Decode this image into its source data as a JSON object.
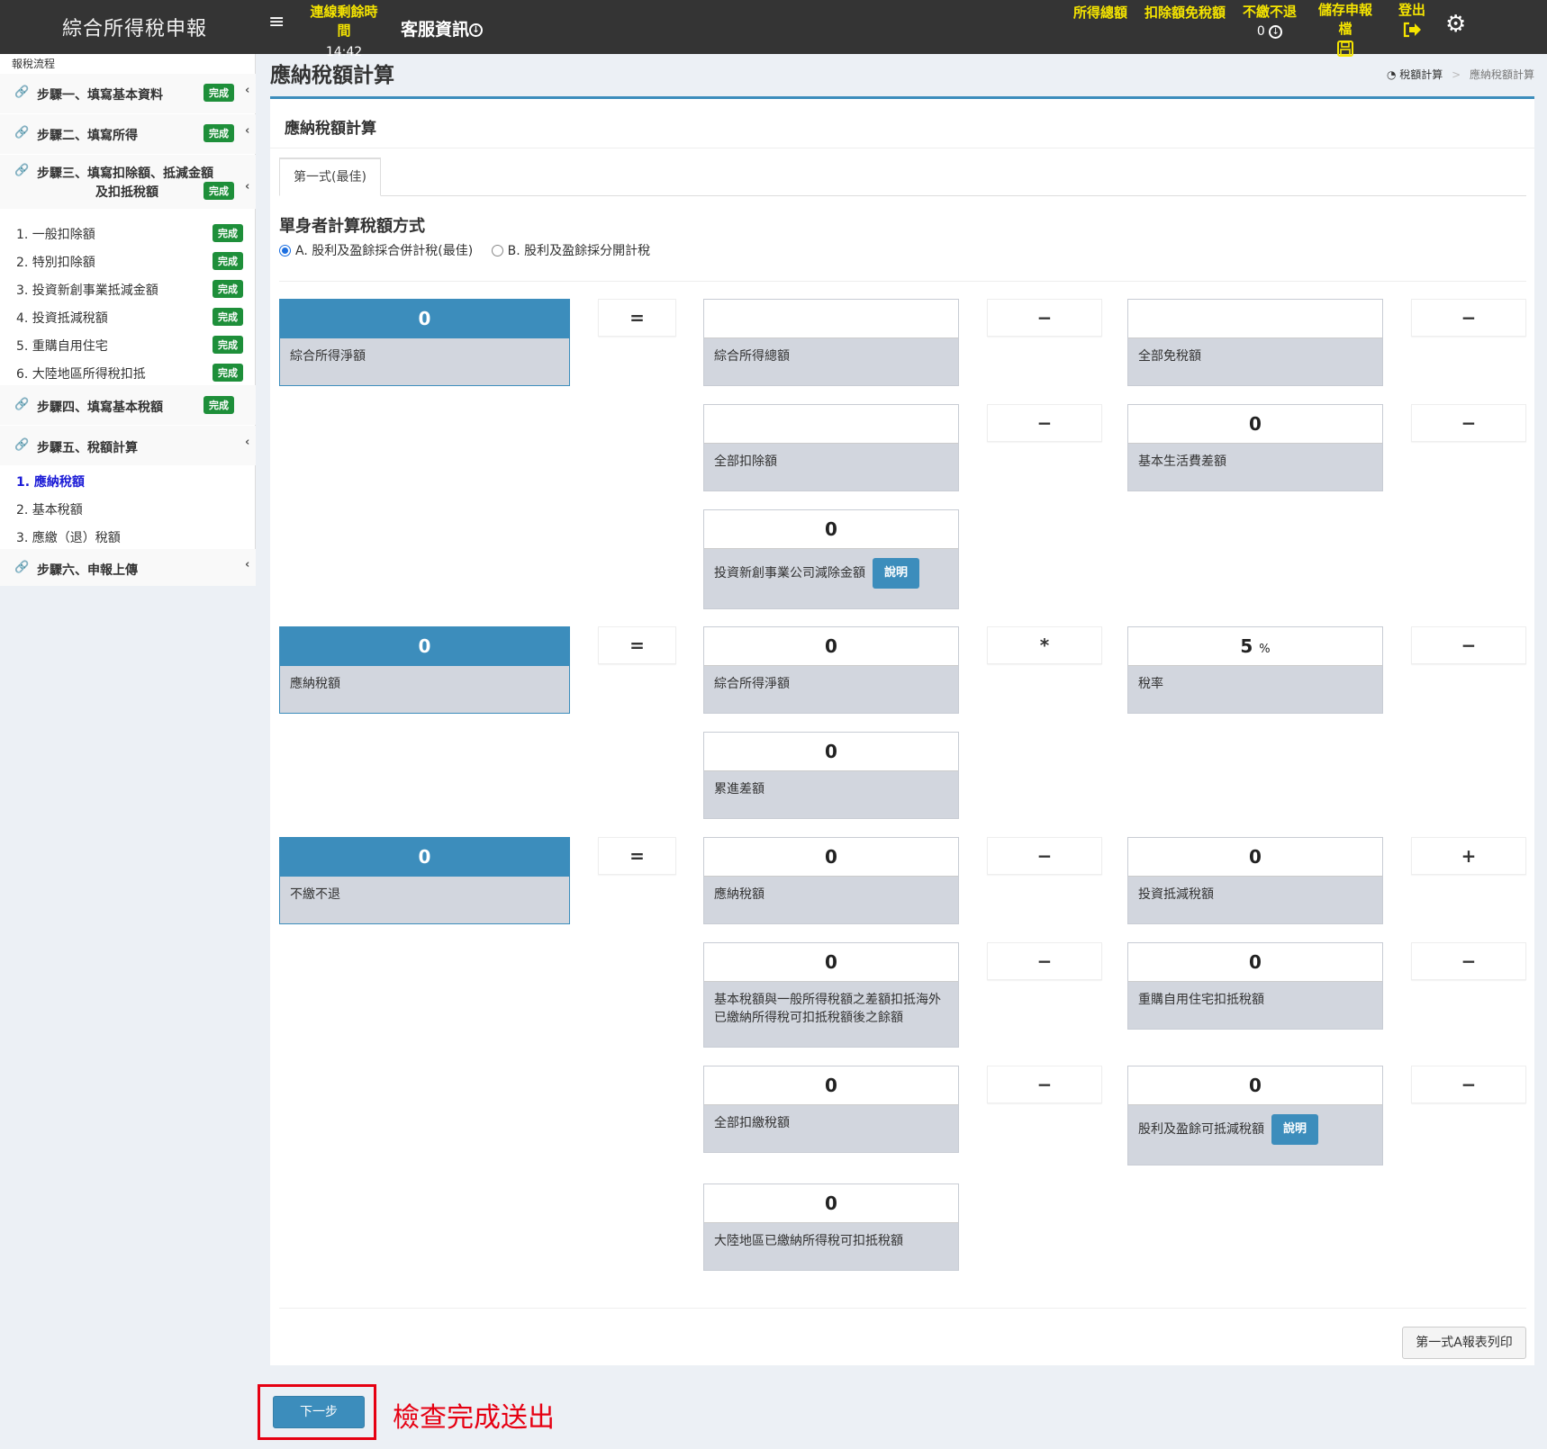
{
  "topbar": {
    "app_title": "綜合所得稅申報",
    "timer_label": "連線剩餘時間",
    "timer_value": "14:42",
    "service_label": "客服資訊",
    "income_total_label": "所得總額",
    "deduction_label": "扣除額免稅額",
    "refund_label": "不繳不退",
    "refund_value": "0",
    "save_label": "儲存申報檔",
    "logout_label": "登出"
  },
  "sidebar": {
    "header": "報稅流程",
    "steps": [
      {
        "label": "步驟一、填寫基本資料",
        "badge": "完成"
      },
      {
        "label": "步驟二、填寫所得",
        "badge": "完成"
      },
      {
        "label": "步驟三、填寫扣除額、抵減金額",
        "label2": "及扣抵稅額",
        "badge": "完成"
      },
      {
        "label": "步驟四、填寫基本稅額",
        "badge": "完成"
      },
      {
        "label": "步驟五、稅額計算"
      },
      {
        "label": "步驟六、申報上傳"
      }
    ],
    "step3_subs": [
      {
        "label": "1. 一般扣除額",
        "badge": "完成"
      },
      {
        "label": "2. 特別扣除額",
        "badge": "完成"
      },
      {
        "label": "3. 投資新創事業抵減金額",
        "badge": "完成"
      },
      {
        "label": "4. 投資抵減稅額",
        "badge": "完成"
      },
      {
        "label": "5. 重購自用住宅",
        "badge": "完成"
      },
      {
        "label": "6. 大陸地區所得稅扣抵",
        "badge": "完成"
      }
    ],
    "step5_subs": [
      {
        "label": "1. 應納稅額"
      },
      {
        "label": "2. 基本稅額"
      },
      {
        "label": "3. 應繳（退）稅額"
      }
    ]
  },
  "page": {
    "title": "應納稅額計算",
    "breadcrumb_home": "稅額計算",
    "breadcrumb_sep": ">",
    "breadcrumb_current": "應納稅額計算"
  },
  "panel": {
    "title": "應納稅額計算",
    "tab": "第一式(最佳)",
    "section_title": "單身者計算稅額方式",
    "option_a": "A. 股利及盈餘採合併計稅(最佳)",
    "option_b": "B. 股利及盈餘採分開計稅",
    "explain_label": "說明",
    "print_label": "第一式A報表列印"
  },
  "ops": {
    "eq": "=",
    "minus": "−",
    "plus": "+",
    "mul": "*"
  },
  "formula": {
    "net_income": {
      "value": "0",
      "label": "綜合所得淨額"
    },
    "gross_income": {
      "value": "",
      "label": "綜合所得總額"
    },
    "exemptions": {
      "value": "",
      "label": "全部免稅額"
    },
    "deductions": {
      "value": "",
      "label": "全部扣除額"
    },
    "basic_living": {
      "value": "0",
      "label": "基本生活費差額"
    },
    "startup_invest": {
      "value": "0",
      "label": "投資新創事業公司減除金額"
    },
    "tax_payable": {
      "value": "0",
      "label": "應納稅額"
    },
    "net_income2": {
      "value": "0",
      "label": "綜合所得淨額"
    },
    "rate": {
      "value": "5",
      "unit": "%",
      "label": "稅率"
    },
    "progressive": {
      "value": "0",
      "label": "累進差額"
    },
    "no_pay_no_refund": {
      "value": "0",
      "label": "不繳不退"
    },
    "tax_payable2": {
      "value": "0",
      "label": "應納稅額"
    },
    "invest_credit": {
      "value": "0",
      "label": "投資抵減稅額"
    },
    "basic_diff": {
      "value": "0",
      "label": "基本稅額與一般所得稅額之差額扣抵海外已繳納所得稅可扣抵稅額後之餘額"
    },
    "house_credit": {
      "value": "0",
      "label": "重購自用住宅扣抵稅額"
    },
    "withholding": {
      "value": "0",
      "label": "全部扣繳稅額"
    },
    "dividend_credit": {
      "value": "0",
      "label": "股利及盈餘可抵減稅額"
    },
    "mainland_credit": {
      "value": "0",
      "label": "大陸地區已繳納所得稅可扣抵稅額"
    }
  },
  "footer": {
    "next_label": "下一步",
    "annotation": "檢查完成送出"
  }
}
